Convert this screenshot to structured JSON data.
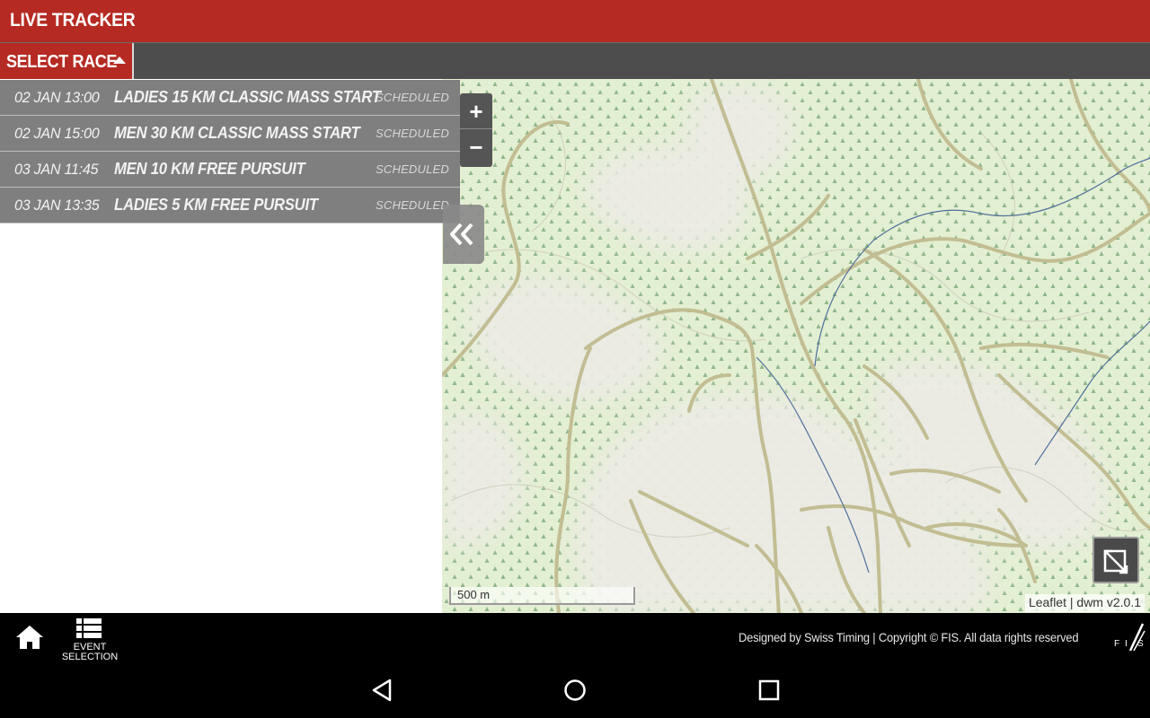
{
  "app": {
    "title": "LIVE TRACKER"
  },
  "toolbar": {
    "select_race_label": "SELECT RACE"
  },
  "races": [
    {
      "time": "02 JAN 13:00",
      "name": "LADIES 15 KM CLASSIC MASS START",
      "status": "SCHEDULED"
    },
    {
      "time": "02 JAN 15:00",
      "name": "MEN 30 KM CLASSIC MASS START",
      "status": "SCHEDULED"
    },
    {
      "time": "03 JAN 11:45",
      "name": "MEN 10 KM FREE PURSUIT",
      "status": "SCHEDULED"
    },
    {
      "time": "03 JAN 13:35",
      "name": "LADIES 5 KM FREE PURSUIT",
      "status": "SCHEDULED"
    }
  ],
  "map": {
    "zoom_in": "+",
    "zoom_out": "−",
    "scale_label": "500 m",
    "attribution": "Leaflet | dwm v2.0.1"
  },
  "footer": {
    "event_selection_line1": "EVENT",
    "event_selection_line2": "SELECTION",
    "copyright": "Designed by Swiss Timing | Copyright © FIS. All data rights reserved",
    "logo_text": "FIS"
  },
  "icons": {
    "home": "home-icon",
    "event_selection": "list-icon",
    "collapse": "double-chevron-left-icon",
    "fullscreen": "fullscreen-icon",
    "nav_back": "back-triangle-icon",
    "nav_home": "home-circle-icon",
    "nav_recents": "recents-square-icon"
  },
  "colors": {
    "brand_red": "#b52a22",
    "toolbar_gray": "#4d4d4d",
    "row_gray": "#7f7f7f",
    "map_green": "#e3efd2",
    "trail": "#c2bd92",
    "river": "#4f6f9c"
  }
}
